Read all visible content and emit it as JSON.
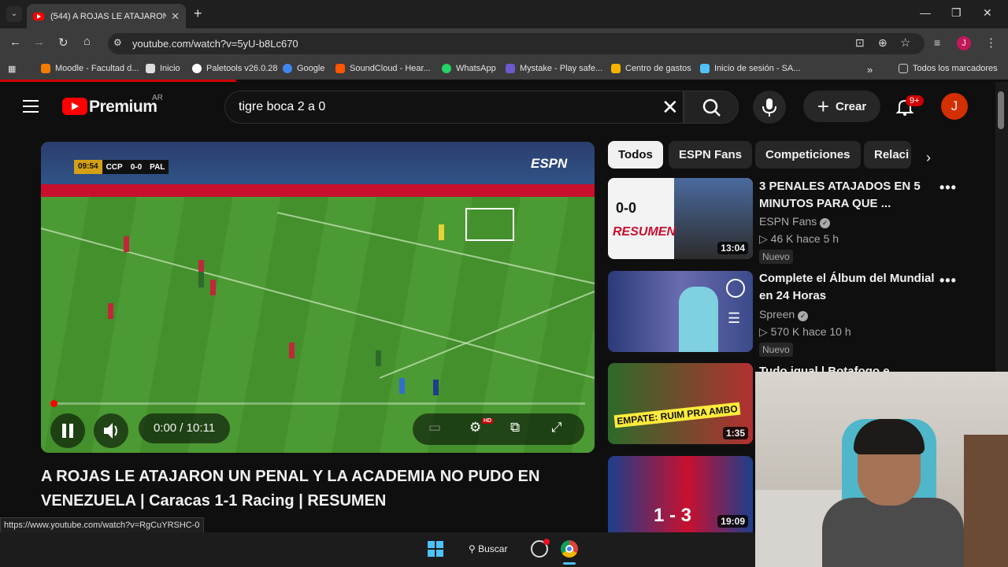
{
  "browser": {
    "tab_title": "(544) A ROJAS LE ATAJARON U",
    "url": "youtube.com/watch?v=5yU-b8Lc670",
    "bookmarks": [
      {
        "label": "Moodle - Facultad d...",
        "color": "#f57c00"
      },
      {
        "label": "Inicio",
        "color": "#dddddd"
      },
      {
        "label": "Paletools v26.0.28",
        "color": "#ffffff"
      },
      {
        "label": "Google",
        "color": "#4285f4"
      },
      {
        "label": "SoundCloud - Hear...",
        "color": "#ff5500"
      },
      {
        "label": "WhatsApp",
        "color": "#25d366"
      },
      {
        "label": "Mystake - Play safe...",
        "color": "#6a5acd"
      },
      {
        "label": "Centro de gastos",
        "color": "#f4b400"
      },
      {
        "label": "Inicio de sesión - SA...",
        "color": "#4fc3f7"
      }
    ],
    "all_bookmarks": "Todos los marcadores",
    "status_url": "https://www.youtube.com/watch?v=RgCuYRSHC-0"
  },
  "youtube": {
    "brand": "Premium",
    "country": "AR",
    "search_query": "tigre boca 2 a 0",
    "create_label": "Crear",
    "notifications_badge": "9+",
    "avatar_letter": "J"
  },
  "player": {
    "time": "0:00 / 10:11",
    "scorebug": {
      "clock": "09:54",
      "home": "CCP",
      "score": "0-0",
      "away": "PAL"
    },
    "network": "ESPN",
    "progress_fraction": 0.0,
    "settings_badge": "HD"
  },
  "video": {
    "title": "A ROJAS LE ATAJARON UN PENAL Y LA ACADEMIA NO PUDO EN VENEZUELA | Caracas 1-1 Racing | RESUMEN"
  },
  "chips": [
    "Todos",
    "ESPN Fans",
    "Competiciones",
    "Relaci"
  ],
  "related": [
    {
      "title": "3 PENALES ATAJADOS EN 5 MINUTOS PARA QUE ...",
      "channel": "ESPN Fans",
      "views": "46 K",
      "age": "hace 5 h",
      "badge": "Nuevo",
      "duration": "13:04",
      "thumb_text": "RESUMEN",
      "thumb_score": "0-0"
    },
    {
      "title": "Complete el Álbum del Mundial en 24 Horas",
      "channel": "Spreen",
      "views": "570 K",
      "age": "hace 10 h",
      "badge": "Nuevo",
      "duration": ""
    },
    {
      "title": "Tudo igual | Botafogo e",
      "duration": "1:35",
      "thumb_text": "EMPATE: RUIM PRA AMBO"
    },
    {
      "title": "",
      "duration": "19:09",
      "thumb_score": "1 - 3"
    }
  ],
  "taskbar": {
    "search_label": "Buscar"
  }
}
